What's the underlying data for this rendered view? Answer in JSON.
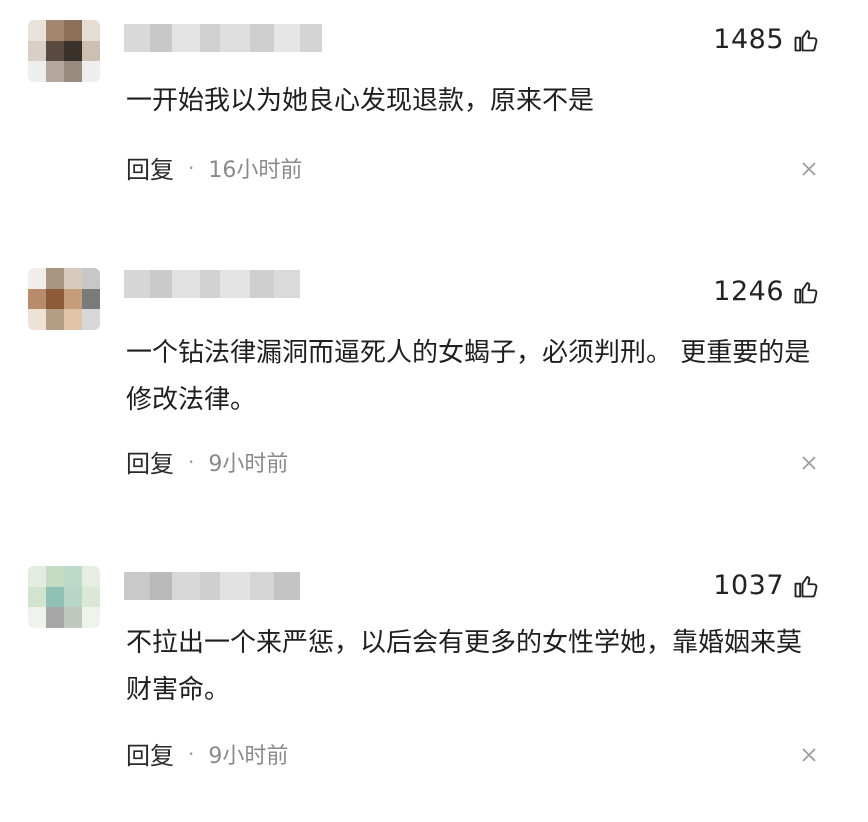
{
  "comments": [
    {
      "likes": "1485",
      "text": "一开始我以为她良心发现退款，原来不是",
      "reply_label": "回复",
      "separator": "·",
      "time": "16小时前",
      "avatar_colors": [
        "#e9e2da",
        "#a48770",
        "#8c6f58",
        "#e6ddd3",
        "#d9cfc6",
        "#5a4a40",
        "#3a312b",
        "#cdbfb2",
        "#eeeeee",
        "#b4a79b",
        "#9a8b7f",
        "#eeeeee"
      ],
      "username_colors": [
        "#d9d9d9",
        "#c8c8c8",
        "#e3e3e3",
        "#d0d0d0",
        "#dedede",
        "#cfcfcf",
        "#e6e6e6",
        "#d4d4d4"
      ]
    },
    {
      "likes": "1246",
      "text": "一个钻法律漏洞而逼死人的女蝎子，必须判刑。 更重要的是修改法律。",
      "reply_label": "回复",
      "separator": "·",
      "time": "9小时前",
      "avatar_colors": [
        "#f1ede8",
        "#a9957f",
        "#d6cbbd",
        "#c7c7c7",
        "#b88c6a",
        "#8d5b38",
        "#c69d7a",
        "#7a7a7a",
        "#eee2d6",
        "#b69d86",
        "#e0c4a8",
        "#d7d7d7"
      ],
      "username_colors": [
        "#d6d6d6",
        "#cacaca",
        "#e1e1e1",
        "#d2d2d2",
        "#e4e4e4",
        "#cfcfcf",
        "#dadada"
      ]
    },
    {
      "likes": "1037",
      "text": "不拉出一个来严惩，以后会有更多的女性学她，靠婚姻来莫财害命。",
      "reply_label": "回复",
      "separator": "·",
      "time": "9小时前",
      "avatar_colors": [
        "#e2ece0",
        "#c6dcc3",
        "#bcd9c9",
        "#e6eee4",
        "#d2e3cf",
        "#8fc1b5",
        "#b8d6c7",
        "#dbe8d8",
        "#eef3ec",
        "#a7a7a7",
        "#bfc9bd",
        "#eef3ec"
      ],
      "username_colors": [
        "#c9c9c9",
        "#b9b9b9",
        "#d8d8d8",
        "#cfcfcf",
        "#e2e2e2",
        "#d5d5d5",
        "#c4c4c4"
      ]
    }
  ],
  "icons": {
    "like": "thumbs-up-icon",
    "close": "close-icon"
  }
}
